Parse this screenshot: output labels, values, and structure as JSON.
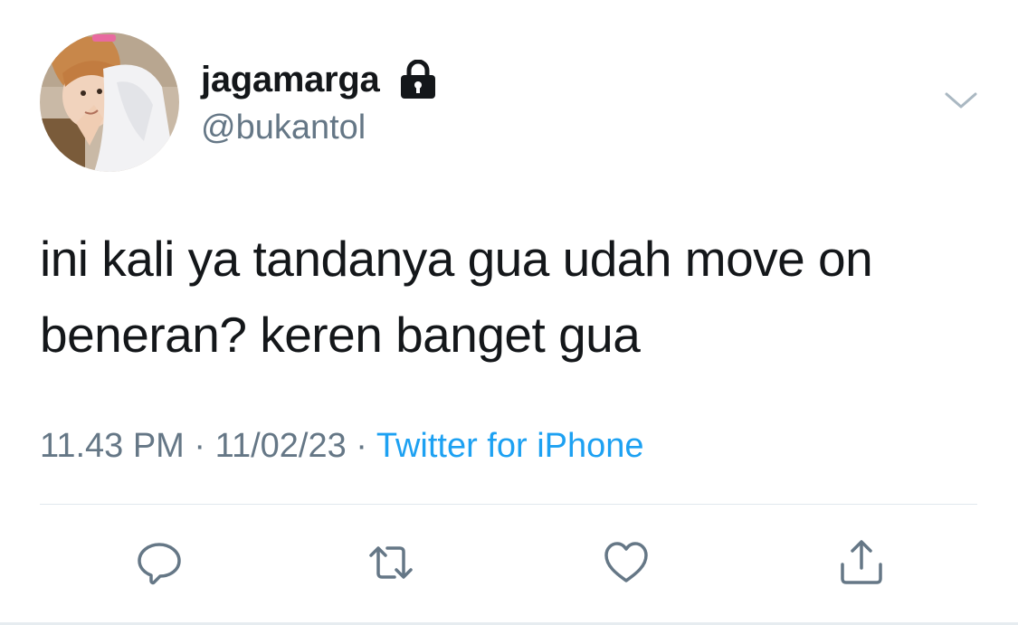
{
  "user": {
    "display_name": "jagamarga",
    "handle": "@bukantol",
    "protected_icon": "lock-icon",
    "avatar": "profile-photo"
  },
  "tweet": {
    "text": "ini kali ya tandanya gua udah move on beneran? keren banget gua",
    "time": "11.43 PM",
    "separator": "·",
    "date": "11/02/23",
    "source": "Twitter for iPhone"
  },
  "actions": [
    "reply-icon",
    "retweet-icon",
    "like-icon",
    "share-icon"
  ],
  "colors": {
    "text": "#14171a",
    "secondary": "#657786",
    "link": "#1da1f2",
    "divider": "#e1e8ed"
  }
}
